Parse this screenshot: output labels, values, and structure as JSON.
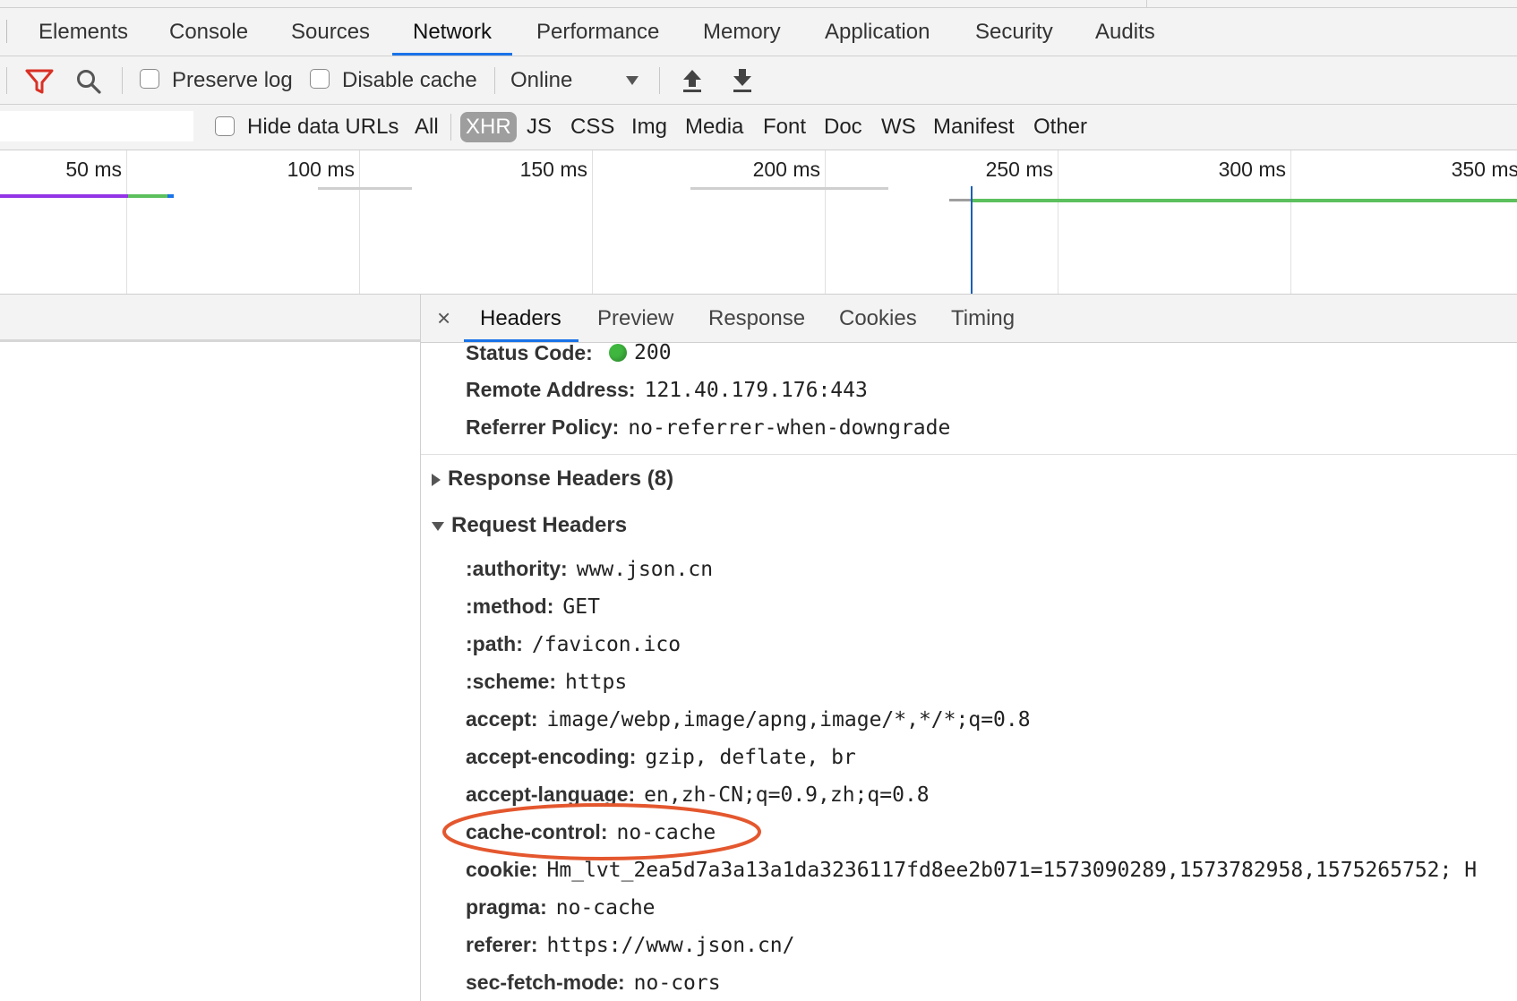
{
  "top_tabs": [
    "Elements",
    "Console",
    "Sources",
    "Network",
    "Performance",
    "Memory",
    "Application",
    "Security",
    "Audits"
  ],
  "active_top_tab": "Network",
  "toolbar": {
    "preserve_log_label": "Preserve log",
    "preserve_log_checked": false,
    "disable_cache_label": "Disable cache",
    "disable_cache_checked": false,
    "throttle_value": "Online",
    "icons": [
      "filter-icon",
      "search-icon",
      "import-har-icon",
      "export-har-icon"
    ]
  },
  "filter": {
    "input_value": "",
    "hide_data_urls_label": "Hide data URLs",
    "hide_data_urls_checked": false,
    "types": [
      "All",
      "XHR",
      "JS",
      "CSS",
      "Img",
      "Media",
      "Font",
      "Doc",
      "WS",
      "Manifest",
      "Other"
    ],
    "selected_type": "XHR"
  },
  "timeline": {
    "ticks": [
      "50 ms",
      "100 ms",
      "150 ms",
      "200 ms",
      "250 ms",
      "300 ms",
      "350 ms"
    ],
    "colors": {
      "purple": "#9334e6",
      "green": "#5cc05c",
      "blue": "#1a73e8",
      "grey": "#cfcfcf"
    }
  },
  "detail": {
    "close_icon": "×",
    "tabs": [
      "Headers",
      "Preview",
      "Response",
      "Cookies",
      "Timing"
    ],
    "active_tab": "Headers",
    "general": [
      {
        "key": "Status Code:",
        "value": "200",
        "status_dot": "#3fb73f"
      },
      {
        "key": "Remote Address:",
        "value": "121.40.179.176:443"
      },
      {
        "key": "Referrer Policy:",
        "value": "no-referrer-when-downgrade"
      }
    ],
    "response_headers_title": "Response Headers (8)",
    "request_headers_title": "Request Headers",
    "request_headers": [
      {
        "key": ":authority:",
        "value": "www.json.cn"
      },
      {
        "key": ":method:",
        "value": "GET"
      },
      {
        "key": ":path:",
        "value": "/favicon.ico"
      },
      {
        "key": ":scheme:",
        "value": "https"
      },
      {
        "key": "accept:",
        "value": "image/webp,image/apng,image/*,*/*;q=0.8"
      },
      {
        "key": "accept-encoding:",
        "value": "gzip, deflate, br"
      },
      {
        "key": "accept-language:",
        "value": "en,zh-CN;q=0.9,zh;q=0.8"
      },
      {
        "key": "cache-control:",
        "value": "no-cache"
      },
      {
        "key": "cookie:",
        "value": "Hm_lvt_2ea5d7a3a13a1da3236117fd8ee2b071=1573090289,1573782958,1575265752; H"
      },
      {
        "key": "pragma:",
        "value": "no-cache"
      },
      {
        "key": "referer:",
        "value": "https://www.json.cn/"
      },
      {
        "key": "sec-fetch-mode:",
        "value": "no-cors"
      }
    ],
    "highlight_color": "#e4572e"
  }
}
